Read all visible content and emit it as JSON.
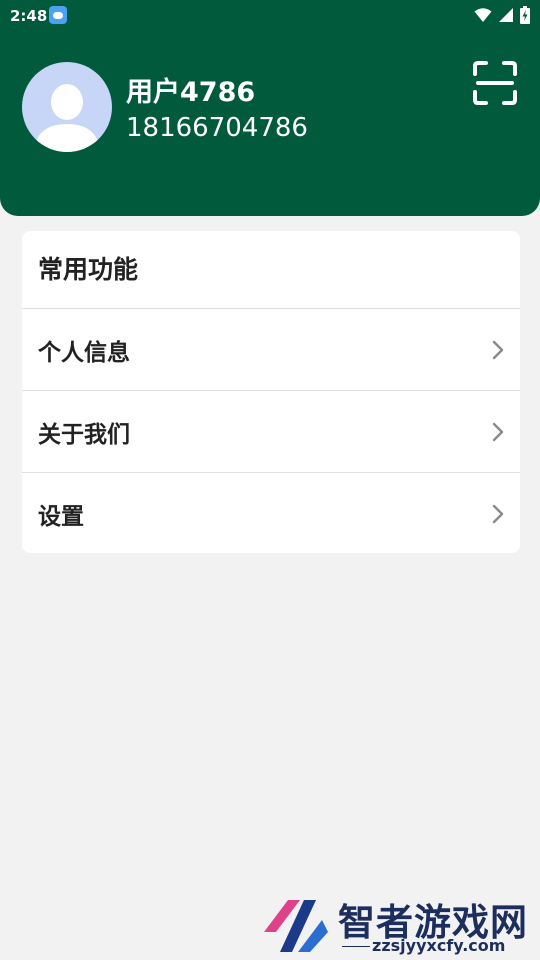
{
  "status_bar": {
    "time": "2:48",
    "app_icon": "weather-app-icon",
    "icons": [
      "wifi-icon",
      "cell-signal-icon",
      "battery-charging-icon"
    ]
  },
  "profile": {
    "name": "用户4786",
    "phone": "18166704786",
    "avatar_icon": "default-user-avatar",
    "scan_icon": "scan-icon"
  },
  "section": {
    "title": "常用功能",
    "items": [
      {
        "label": "个人信息",
        "icon": "chevron-right-icon"
      },
      {
        "label": "关于我们",
        "icon": "chevron-right-icon"
      },
      {
        "label": "设置",
        "icon": "chevron-right-icon"
      }
    ]
  },
  "watermark": {
    "title": "智者游戏网",
    "url": "zzsjyyxcfy.com"
  },
  "colors": {
    "header_bg": "#005a3b",
    "page_bg": "#f2f2f2",
    "card_bg": "#ffffff",
    "avatar_bg": "#c7d6f7",
    "text_primary": "#222222",
    "watermark_text": "#1c2e5e"
  }
}
